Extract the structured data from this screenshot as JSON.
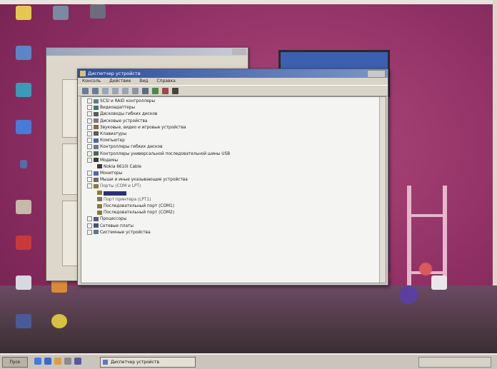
{
  "main_window": {
    "title": "Диспетчер устройств",
    "menu": [
      "Консоль",
      "Действие",
      "Вид",
      "Справка"
    ],
    "tree": [
      {
        "label": "SCSI и RAID контроллеры",
        "level": 0,
        "icon": "controller-icon"
      },
      {
        "label": "Видеоадаптеры",
        "level": 0,
        "icon": "display-adapter-icon"
      },
      {
        "label": "Дисководы гибких дисков",
        "level": 0,
        "icon": "floppy-icon"
      },
      {
        "label": "Дисковые устройства",
        "level": 0,
        "icon": "disk-icon"
      },
      {
        "label": "Звуковые, видео и игровые устройства",
        "level": 0,
        "icon": "sound-icon"
      },
      {
        "label": "Клавиатуры",
        "level": 0,
        "icon": "keyboard-icon"
      },
      {
        "label": "Компьютер",
        "level": 0,
        "icon": "computer-icon"
      },
      {
        "label": "Контроллеры гибких дисков",
        "level": 0,
        "icon": "controller-icon"
      },
      {
        "label": "Контроллеры универсальной последовательной шины USB",
        "level": 0,
        "icon": "usb-icon"
      },
      {
        "label": "Модемы",
        "level": 0,
        "icon": "modem-icon",
        "expanded": true
      },
      {
        "label": "Nokia 6610i Cable",
        "level": 1,
        "icon": "modem-icon"
      },
      {
        "label": "Мониторы",
        "level": 0,
        "icon": "monitor-icon"
      },
      {
        "label": "Мыши и иные указывающие устройства",
        "level": 0,
        "icon": "mouse-icon"
      },
      {
        "label": "Порты (COM и LPT)",
        "level": 0,
        "icon": "port-icon",
        "expanded": true,
        "dim": true
      },
      {
        "label": "",
        "level": 1,
        "icon": "port-icon",
        "selected": true
      },
      {
        "label": "Порт принтера (LPT1)",
        "level": 1,
        "icon": "printer-port-icon",
        "dim": true
      },
      {
        "label": "Последовательный порт (COM1)",
        "level": 1,
        "icon": "port-icon"
      },
      {
        "label": "Последовательный порт (COM2)",
        "level": 1,
        "icon": "port-icon"
      },
      {
        "label": "Процессоры",
        "level": 0,
        "icon": "cpu-icon"
      },
      {
        "label": "Сетевые платы",
        "level": 0,
        "icon": "network-icon"
      },
      {
        "label": "Системные устройства",
        "level": 0,
        "icon": "system-icon"
      }
    ]
  },
  "taskbar": {
    "start_label": "Пуск",
    "task_label": "Диспетчер устройств"
  },
  "colors": {
    "desktop": "#9a3a6c",
    "title_active": "#2e4f9e",
    "selection": "#2a2f78"
  }
}
